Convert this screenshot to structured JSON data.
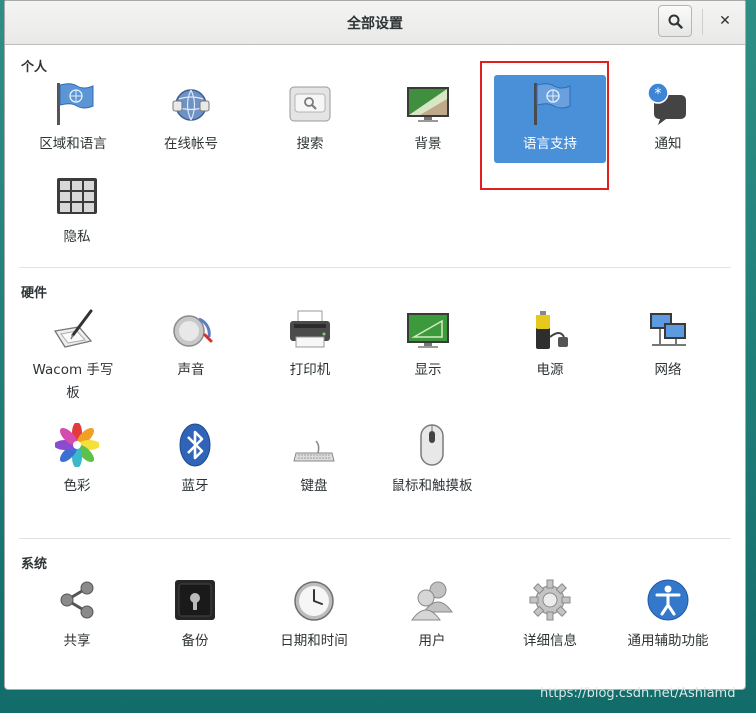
{
  "window": {
    "title": "全部设置"
  },
  "sections": [
    {
      "label": "个人",
      "items": [
        {
          "label": "区域和语言",
          "icon": "flag-icon"
        },
        {
          "label": "在线帐号",
          "icon": "online-accounts-icon"
        },
        {
          "label": "搜索",
          "icon": "search-settings-icon"
        },
        {
          "label": "背景",
          "icon": "background-icon"
        },
        {
          "label": "语言支持",
          "icon": "language-flag-icon",
          "selected": true
        },
        {
          "label": "通知",
          "icon": "notification-icon"
        },
        {
          "label": "隐私",
          "icon": "privacy-icon"
        }
      ]
    },
    {
      "label": "硬件",
      "items": [
        {
          "label": "Wacom 手写板",
          "icon": "wacom-tablet-icon"
        },
        {
          "label": "声音",
          "icon": "sound-icon"
        },
        {
          "label": "打印机",
          "icon": "printer-icon"
        },
        {
          "label": "显示",
          "icon": "display-icon"
        },
        {
          "label": "电源",
          "icon": "power-icon"
        },
        {
          "label": "网络",
          "icon": "network-icon"
        },
        {
          "label": "色彩",
          "icon": "color-icon"
        },
        {
          "label": "蓝牙",
          "icon": "bluetooth-icon"
        },
        {
          "label": "键盘",
          "icon": "keyboard-icon"
        },
        {
          "label": "鼠标和触摸板",
          "icon": "mouse-icon"
        }
      ]
    },
    {
      "label": "系统",
      "items": [
        {
          "label": "共享",
          "icon": "share-icon"
        },
        {
          "label": "备份",
          "icon": "backup-safe-icon"
        },
        {
          "label": "日期和时间",
          "icon": "clock-icon"
        },
        {
          "label": "用户",
          "icon": "users-icon"
        },
        {
          "label": "详细信息",
          "icon": "gear-icon"
        },
        {
          "label": "通用辅助功能",
          "icon": "accessibility-icon"
        }
      ]
    }
  ],
  "watermark": "https://blog.csdn.net/Ashiamd",
  "colors": {
    "selected": "#4a90d9",
    "annotation": "#e02020"
  }
}
